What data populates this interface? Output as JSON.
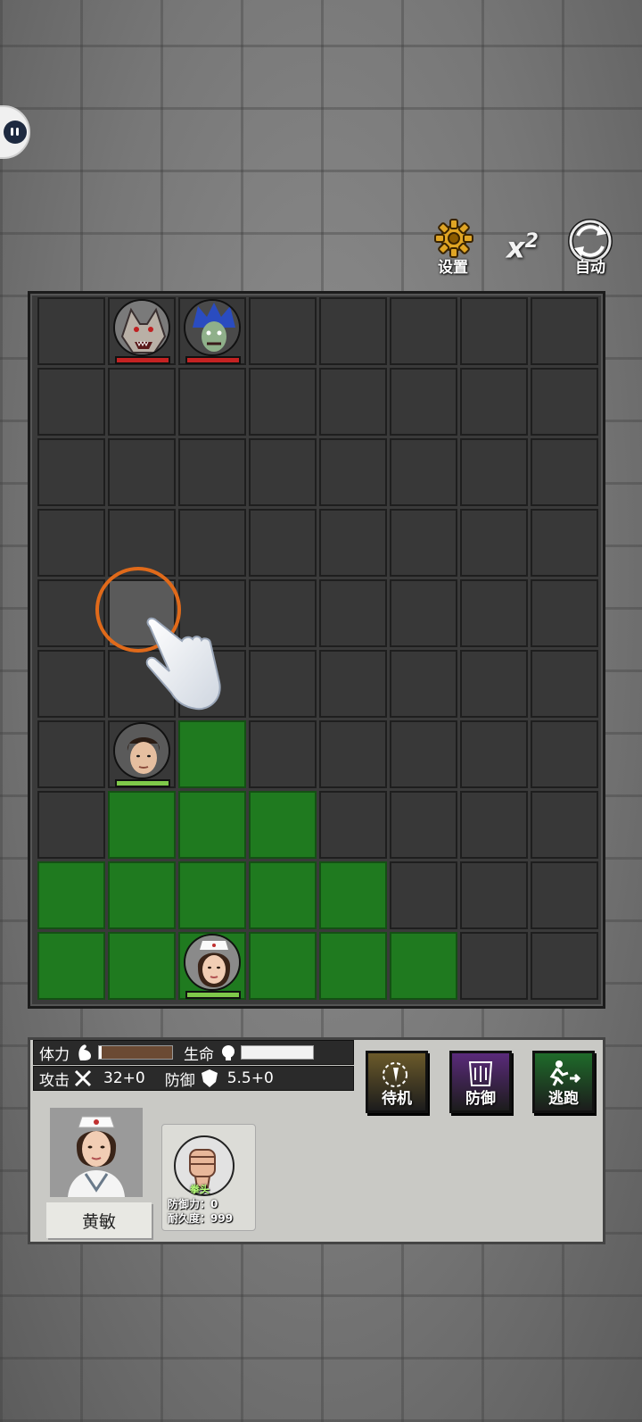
{
  "controls": {
    "settings_label": "设置",
    "speed_label": "x",
    "speed_value": "2",
    "auto_label": "自动"
  },
  "board": {
    "cols": 8,
    "rows": 10,
    "move_cells": [
      [
        2,
        6
      ],
      [
        1,
        7
      ],
      [
        2,
        7
      ],
      [
        3,
        7
      ],
      [
        0,
        8
      ],
      [
        1,
        8
      ],
      [
        2,
        8
      ],
      [
        3,
        8
      ],
      [
        4,
        8
      ],
      [
        0,
        9
      ],
      [
        1,
        9
      ],
      [
        2,
        9
      ],
      [
        3,
        9
      ],
      [
        4,
        9
      ],
      [
        5,
        9
      ]
    ],
    "highlight_cell": [
      1,
      4
    ],
    "units": [
      {
        "name": "wolf-enemy",
        "col": 1,
        "row": 0,
        "team": "enemy",
        "hp": 1.0
      },
      {
        "name": "blue-hair-enemy",
        "col": 2,
        "row": 0,
        "team": "enemy",
        "hp": 1.0
      },
      {
        "name": "young-man-ally",
        "col": 1,
        "row": 6,
        "team": "ally",
        "hp": 1.0
      },
      {
        "name": "nurse-player",
        "col": 2,
        "row": 9,
        "team": "player",
        "hp": 1.0
      }
    ]
  },
  "colors": {
    "enemy_hp": "#c42222",
    "ally_hp": "#7fc94a",
    "move_cell": "#1f7a1f",
    "ring": "#e06a1a"
  },
  "panel": {
    "stamina_label": "体力",
    "stamina_value": 0.04,
    "life_label": "生命",
    "life_value": 1.0,
    "attack_label": "攻击",
    "attack_value": "32+0",
    "defense_label": "防御",
    "defense_value": "5.5+0",
    "actions": [
      {
        "label": "待机",
        "icon": "standby-icon",
        "color": "#6b5a2a"
      },
      {
        "label": "防御",
        "icon": "defend-icon",
        "color": "#5a2a7a"
      },
      {
        "label": "逃跑",
        "icon": "flee-icon",
        "color": "#1f6b2a"
      }
    ],
    "character_name": "黄敏",
    "weapon_name": "拳头",
    "weapon_defense": "防御力：0",
    "weapon_durability": "耐久度：999"
  }
}
